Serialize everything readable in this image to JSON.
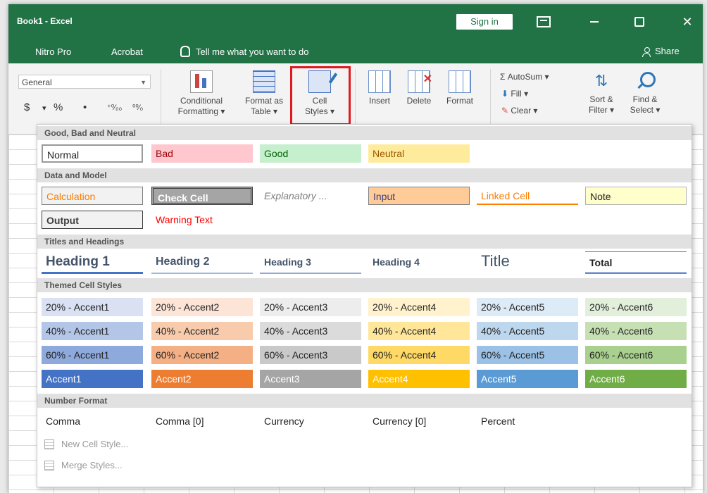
{
  "window": {
    "title": "Book1 - Excel",
    "signin_label": "Sign in",
    "close_glyph": "✕"
  },
  "menu": {
    "items": [
      "Nitro Pro",
      "Acrobat"
    ],
    "tell_me": "Tell me what you want to do",
    "share": "Share"
  },
  "ribbon": {
    "number_format": "General",
    "currency_symbol": "$",
    "percent_symbol": "%",
    "comma_symbol": "•",
    "increase_decimal": "⁺⁰⁄₀₀",
    "decrease_decimal": "⁰⁰⁄₀",
    "conditional_formatting": [
      "Conditional",
      "Formatting ▾"
    ],
    "format_as_table": [
      "Format as",
      "Table ▾"
    ],
    "cell_styles": [
      "Cell",
      "Styles ▾"
    ],
    "insert": "Insert",
    "delete": "Delete",
    "format": "Format",
    "autosum": "Σ AutoSum ▾",
    "fill": "Fill ▾",
    "clear": "Clear ▾",
    "sort_filter": [
      "Sort &",
      "Filter ▾"
    ],
    "find_select": [
      "Find &",
      "Select ▾"
    ]
  },
  "gallery": {
    "sections": {
      "good_bad": "Good, Bad and Neutral",
      "data_model": "Data and Model",
      "titles": "Titles and Headings",
      "themed": "Themed Cell Styles",
      "number_format": "Number Format"
    },
    "good_bad_styles": [
      "Normal",
      "Bad",
      "Good",
      "Neutral"
    ],
    "data_model_styles": [
      "Calculation",
      "Check Cell",
      "Explanatory ...",
      "Input",
      "Linked Cell",
      "Note",
      "Output",
      "Warning Text"
    ],
    "title_styles": [
      "Heading 1",
      "Heading 2",
      "Heading 3",
      "Heading 4",
      "Title",
      "Total"
    ],
    "themed_20": [
      "20% - Accent1",
      "20% - Accent2",
      "20% - Accent3",
      "20% - Accent4",
      "20% - Accent5",
      "20% - Accent6"
    ],
    "themed_40": [
      "40% - Accent1",
      "40% - Accent2",
      "40% - Accent3",
      "40% - Accent4",
      "40% - Accent5",
      "40% - Accent6"
    ],
    "themed_60": [
      "60% - Accent1",
      "60% - Accent2",
      "60% - Accent3",
      "60% - Accent4",
      "60% - Accent5",
      "60% - Accent6"
    ],
    "themed_full": [
      "Accent1",
      "Accent2",
      "Accent3",
      "Accent4",
      "Accent5",
      "Accent6"
    ],
    "number_styles": [
      "Comma",
      "Comma [0]",
      "Currency",
      "Currency [0]",
      "Percent"
    ],
    "new_cell_style": "New Cell Style...",
    "merge_styles": "Merge Styles..."
  },
  "colors": {
    "excel_green": "#217346",
    "highlight_red": "#e0191e",
    "accent1": "#4472c4",
    "accent2": "#ed7d31",
    "accent3": "#a5a5a5",
    "accent4": "#ffc000",
    "accent5": "#5b9bd5",
    "accent6": "#70ad47"
  }
}
